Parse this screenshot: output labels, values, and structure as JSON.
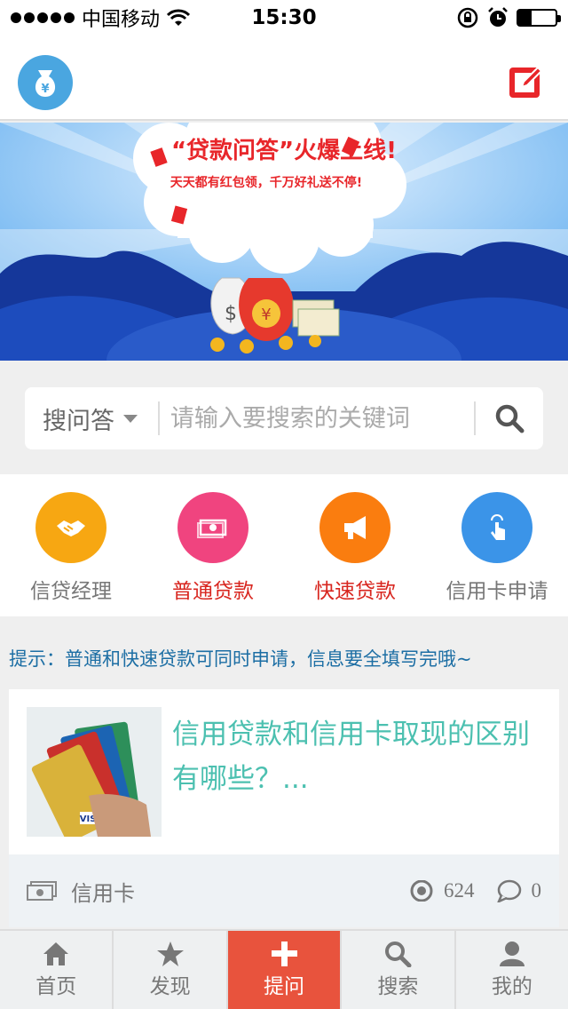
{
  "status_bar": {
    "carrier": "中国移动",
    "time": "15:30",
    "battery_percent": 35
  },
  "header": {
    "logo_icon": "money-bag-icon",
    "edit_icon": "edit-icon",
    "accent_color": "#e8262a"
  },
  "banner": {
    "headline": "“贷款问答”火爆上线!",
    "subline": "天天都有红包领，千万好礼送不停!"
  },
  "search": {
    "type_label": "搜问答",
    "placeholder": "请输入要搜索的关键词"
  },
  "categories": [
    {
      "label": "信贷经理",
      "color": "#f7a712",
      "icon": "handshake-icon",
      "label_color": "#777777"
    },
    {
      "label": "普通贷款",
      "color": "#f0447f",
      "icon": "cash-icon",
      "label_color": "#d8261f"
    },
    {
      "label": "快速贷款",
      "color": "#fa7d0f",
      "icon": "megaphone-icon",
      "label_color": "#d8261f"
    },
    {
      "label": "信用卡申请",
      "color": "#3b94e8",
      "icon": "hand-tap-icon",
      "label_color": "#777777"
    }
  ],
  "tip": "提示：普通和快速贷款可同时申请，信息要全填写完哦~",
  "article": {
    "title": "信用贷款和信用卡取现的区别有哪些？...",
    "tag": "信用卡",
    "views": "624",
    "comments": "0"
  },
  "tabbar": [
    {
      "label": "首页",
      "icon": "home-icon"
    },
    {
      "label": "发现",
      "icon": "star-icon"
    },
    {
      "label": "提问",
      "icon": "plus-icon"
    },
    {
      "label": "搜索",
      "icon": "search-icon"
    },
    {
      "label": "我的",
      "icon": "user-icon"
    }
  ]
}
